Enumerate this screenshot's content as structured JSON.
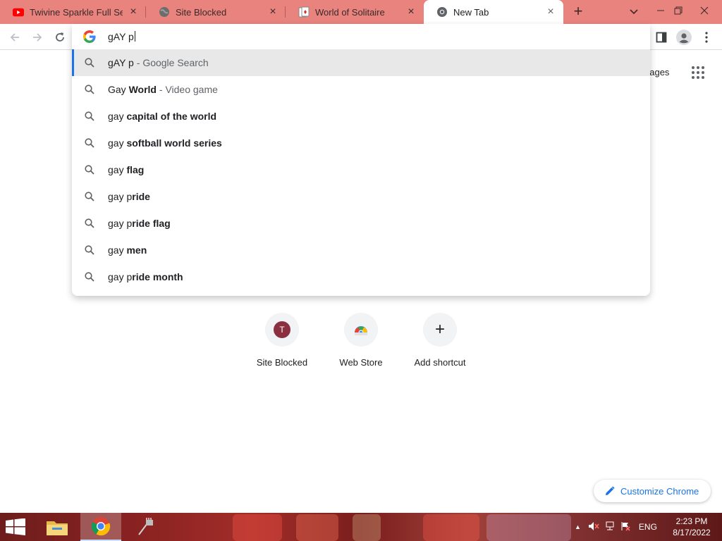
{
  "tabs": [
    {
      "title": "Twivine Sparkle Full Serie",
      "favicon": "youtube-icon",
      "active": false
    },
    {
      "title": "Site Blocked",
      "favicon": "globe-icon",
      "active": false
    },
    {
      "title": "World of Solitaire",
      "favicon": "cards-icon",
      "active": false
    },
    {
      "title": "New Tab",
      "favicon": "chrome-icon",
      "active": true
    }
  ],
  "omnibox": {
    "value": "gAY p"
  },
  "suggestions": [
    {
      "normal": "gAY p",
      "bold": "",
      "description": "Google Search",
      "selected": true
    },
    {
      "normal": "Gay ",
      "bold": "World",
      "description": "Video game",
      "selected": false
    },
    {
      "normal": "gay ",
      "bold": "capital of the world",
      "description": "",
      "selected": false
    },
    {
      "normal": "gay ",
      "bold": "softball world series",
      "description": "",
      "selected": false
    },
    {
      "normal": "gay ",
      "bold": "flag",
      "description": "",
      "selected": false
    },
    {
      "normal": "gay p",
      "bold": "ride",
      "description": "",
      "selected": false
    },
    {
      "normal": "gay p",
      "bold": "ride flag",
      "description": "",
      "selected": false
    },
    {
      "normal": "gay ",
      "bold": "men",
      "description": "",
      "selected": false
    },
    {
      "normal": "gay p",
      "bold": "ride month",
      "description": "",
      "selected": false
    }
  ],
  "ntp": {
    "images_link": "nages",
    "shortcuts": [
      {
        "label": "Site Blocked",
        "badge": "T"
      },
      {
        "label": "Web Store",
        "badge": ""
      },
      {
        "label": "Add shortcut",
        "badge": "+"
      }
    ],
    "customize_label": "Customize Chrome"
  },
  "taskbar": {
    "language": "ENG",
    "time": "2:23 PM",
    "date": "8/17/2022"
  },
  "colors": {
    "tabstrip": "#e8837e",
    "accent": "#1a73e8",
    "taskbar": "#8a2322"
  }
}
